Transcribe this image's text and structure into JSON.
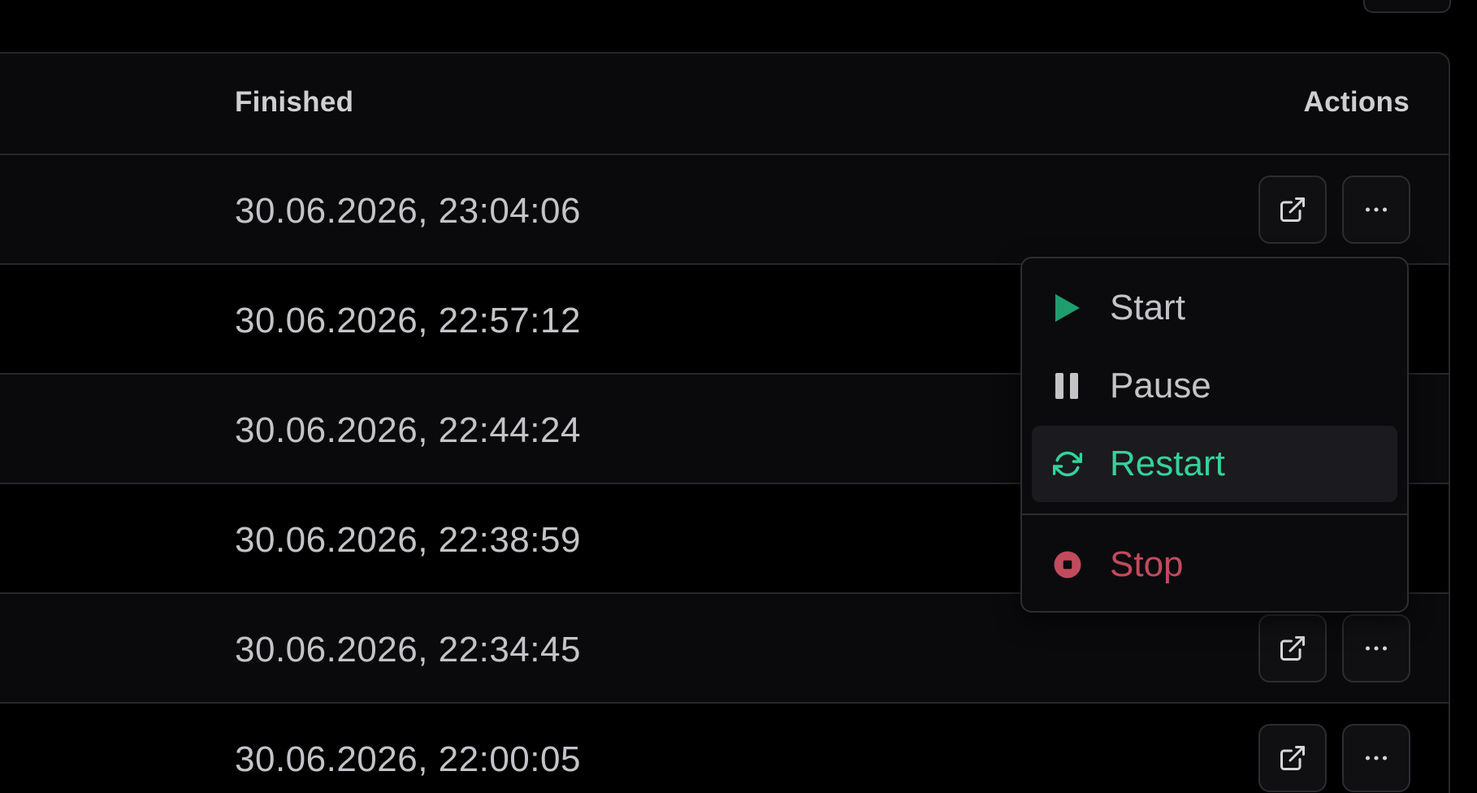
{
  "table": {
    "columns": {
      "finished": "Finished",
      "actions": "Actions"
    },
    "rows": [
      {
        "finished": "30.06.2026, 23:04:06"
      },
      {
        "finished": "30.06.2026, 22:57:12"
      },
      {
        "finished": "30.06.2026, 22:44:24"
      },
      {
        "finished": "30.06.2026, 22:38:59"
      },
      {
        "finished": "30.06.2026, 22:34:45"
      },
      {
        "finished": "30.06.2026, 22:00:05"
      }
    ],
    "row_actions": {
      "open_icon": "external-link-icon",
      "more_icon": "ellipsis-icon"
    }
  },
  "menu": {
    "items": [
      {
        "label": "Start",
        "icon": "play-icon",
        "color": "#1e9e6f"
      },
      {
        "label": "Pause",
        "icon": "pause-icon",
        "color": "#c4c4c8"
      },
      {
        "label": "Restart",
        "icon": "refresh-icon",
        "color": "#34d399",
        "highlighted": true
      },
      {
        "label": "Stop",
        "icon": "stop-circle-icon",
        "color": "#c24a5e"
      }
    ]
  },
  "colors": {
    "background": "#000000",
    "table_bg": "#0a0a0c",
    "border": "#27272b",
    "text": "#c4c4c8"
  }
}
